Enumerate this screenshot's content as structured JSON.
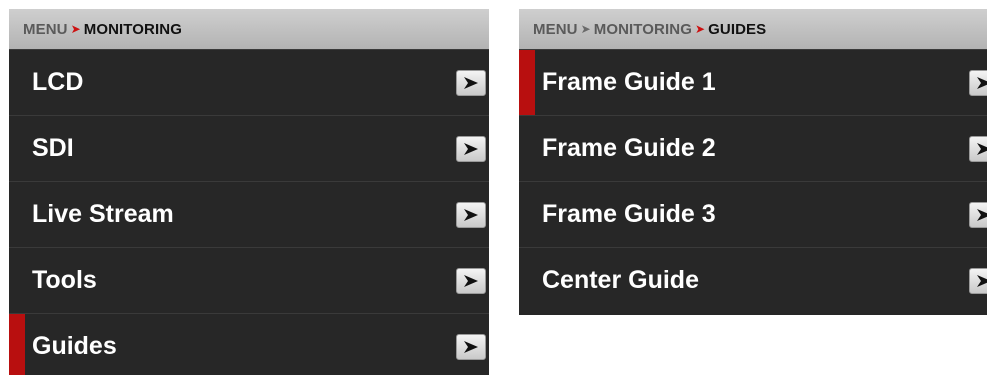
{
  "left_panel": {
    "breadcrumb": [
      {
        "label": "MENU",
        "current": false
      },
      {
        "label": "MONITORING",
        "current": true
      }
    ],
    "separator_icon": "chevron-right-icon",
    "items": [
      {
        "label": "LCD",
        "selected": false
      },
      {
        "label": "SDI",
        "selected": false
      },
      {
        "label": "Live Stream",
        "selected": false
      },
      {
        "label": "Tools",
        "selected": false
      },
      {
        "label": "Guides",
        "selected": true
      }
    ]
  },
  "right_panel": {
    "breadcrumb": [
      {
        "label": "MENU",
        "current": false
      },
      {
        "label": "MONITORING",
        "current": false
      },
      {
        "label": "GUIDES",
        "current": true
      }
    ],
    "items": [
      {
        "label": "Frame Guide 1",
        "selected": true
      },
      {
        "label": "Frame Guide 2",
        "selected": false
      },
      {
        "label": "Frame Guide 3",
        "selected": false
      },
      {
        "label": "Center Guide",
        "selected": false
      }
    ]
  },
  "colors": {
    "panel_background": "#262626",
    "header_gradient_top": "#cfcfcf",
    "header_gradient_bottom": "#b3b3b3",
    "selection_indicator": "#b80f0f",
    "current_separator": "#cc1111",
    "row_text": "#ffffff"
  }
}
